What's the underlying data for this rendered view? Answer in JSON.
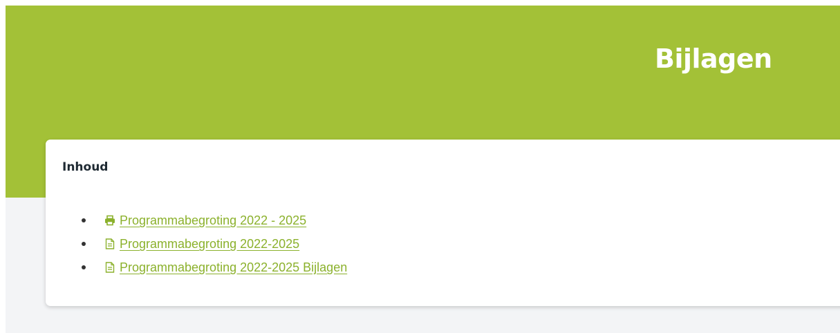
{
  "header": {
    "title": "Bijlagen"
  },
  "toc": {
    "title": "Inhoud",
    "items": [
      {
        "icon": "printer-icon",
        "label": " Programmabegroting 2022 - 2025"
      },
      {
        "icon": "document-icon",
        "label": " Programmabegroting 2022-2025"
      },
      {
        "icon": "document-icon",
        "label": " Programmabegroting 2022-2025 Bijlagen"
      }
    ]
  },
  "colors": {
    "brand_green": "#a3c137",
    "link_green": "#8bb12c",
    "page_background": "#f3f4f6"
  }
}
